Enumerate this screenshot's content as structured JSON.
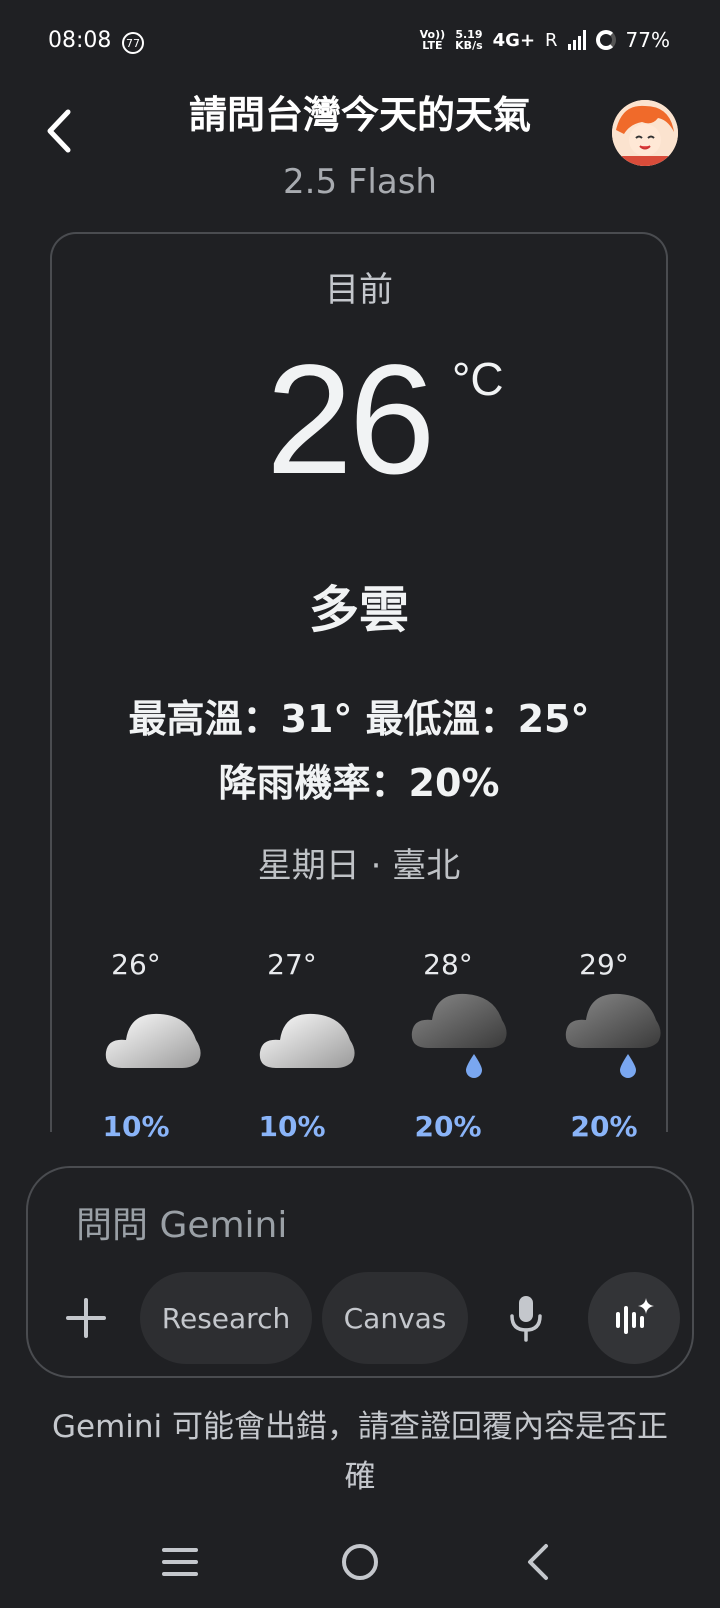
{
  "status_bar": {
    "time": "08:08",
    "notification_count": "77",
    "volte_top": "Vo))",
    "volte_bottom": "LTE",
    "speed_value": "5.19",
    "speed_unit": "KB/s",
    "network": "4G+",
    "roaming": "R",
    "battery": "77%"
  },
  "header": {
    "title": "請問台灣今天的天氣",
    "model": "2.5 Flash"
  },
  "weather": {
    "now_label": "目前",
    "temperature": "26",
    "unit": "°C",
    "condition": "多雲",
    "high_low": "最高溫：31° 最低溫：25°",
    "rain_chance": "降雨機率：20%",
    "day_location": "星期日 · 臺北",
    "hourly": [
      {
        "temp": "26°",
        "icon": "cloud-icon",
        "pct": "10%"
      },
      {
        "temp": "27°",
        "icon": "cloud-icon",
        "pct": "10%"
      },
      {
        "temp": "28°",
        "icon": "rain-cloud-icon",
        "pct": "20%"
      },
      {
        "temp": "29°",
        "icon": "rain-cloud-icon",
        "pct": "20%"
      }
    ]
  },
  "composer": {
    "placeholder": "問問 Gemini",
    "research": "Research",
    "canvas": "Canvas"
  },
  "disclaimer": "Gemini 可能會出錯，請查證回覆內容是否正確"
}
